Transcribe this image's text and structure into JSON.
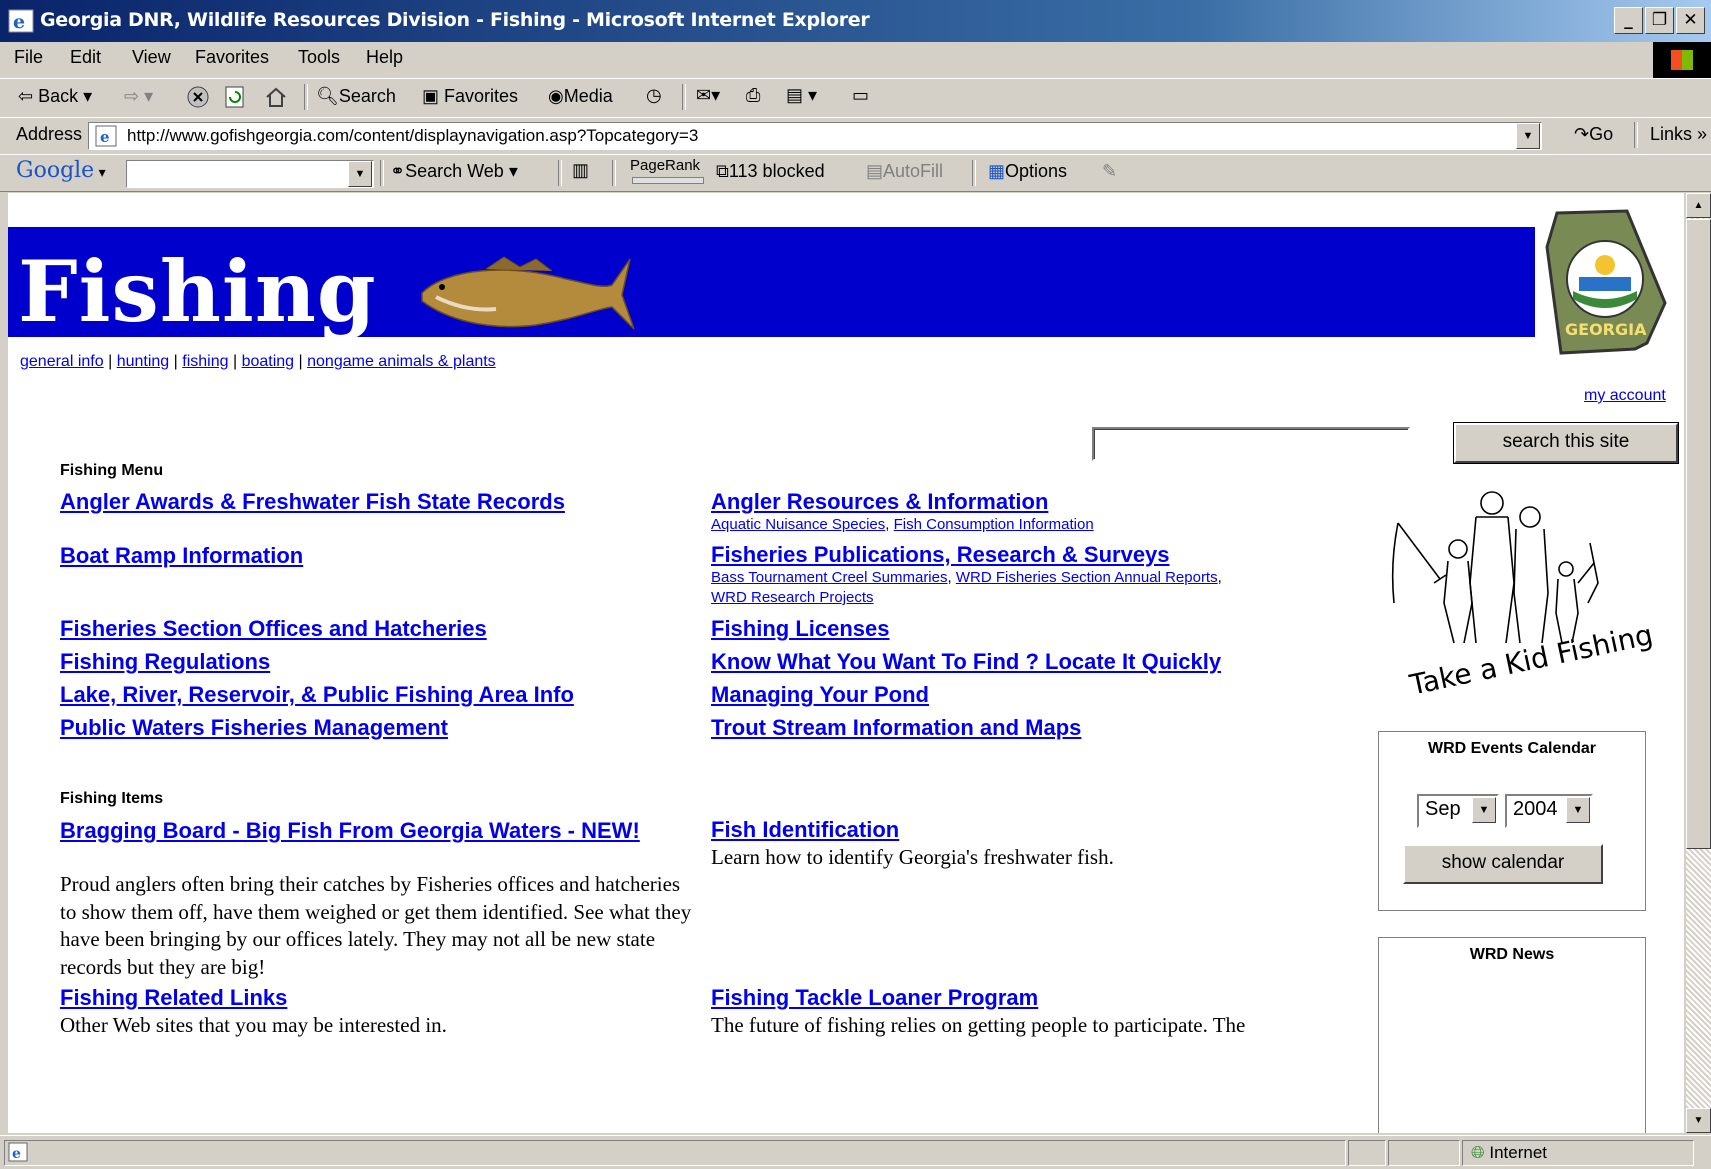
{
  "window": {
    "title": "Georgia DNR, Wildlife Resources Division - Fishing - Microsoft Internet Explorer",
    "min_label": "_",
    "max_label": "❐",
    "close_label": "✕"
  },
  "menu": [
    "File",
    "Edit",
    "View",
    "Favorites",
    "Tools",
    "Help"
  ],
  "toolbar": {
    "back": "Back",
    "search": "Search",
    "favorites": "Favorites",
    "media": "Media"
  },
  "address": {
    "label": "Address",
    "url": "http://www.gofishgeorgia.com/content/displaynavigation.asp?Topcategory=3",
    "go": "Go",
    "links": "Links"
  },
  "google_bar": {
    "logo": "Google",
    "search_web": "Search Web",
    "pagerank": "PageRank",
    "blocked": "113 blocked",
    "autofill": "AutoFill",
    "options": "Options"
  },
  "page": {
    "title": "Fishing",
    "nav": [
      "general info",
      "hunting",
      "fishing",
      "boating",
      "nongame animals & plants"
    ],
    "nav_sep": "|",
    "my_account": "my account",
    "search_button": "search this site",
    "seal_text": "GEORGIA",
    "kid_caption": "Take a Kid Fishing"
  },
  "fishing_menu": {
    "heading": "Fishing Menu",
    "left": [
      "Angler Awards & Freshwater Fish State Records",
      "Boat Ramp Information",
      "Fisheries Section Offices and Hatcheries",
      "Fishing Regulations",
      "Lake, River, Reservoir, & Public Fishing Area Info",
      "Public Waters Fisheries Management"
    ],
    "right": [
      "Angler Resources & Information",
      "Fisheries Publications, Research & Surveys",
      "Fishing Licenses",
      "Know What You Want To Find ? Locate It Quickly",
      "Managing Your Pond",
      "Trout Stream Information and Maps"
    ],
    "angler_sub": [
      "Aquatic Nuisance Species",
      "Fish Consumption Information"
    ],
    "pubs_sub": [
      "Bass Tournament Creel Summaries",
      "WRD Fisheries Section Annual Reports",
      "WRD Research Projects"
    ]
  },
  "fishing_items": {
    "heading": "Fishing Items",
    "bragging_title": "Bragging Board - Big Fish From Georgia Waters - NEW!",
    "bragging_desc": "Proud anglers often bring their catches by Fisheries offices and hatcheries to show them off, have them weighed or get them identified. See what they have been bringing by our offices lately. They may not all be new state records but they are big!",
    "fishid_title": "Fish Identification",
    "fishid_desc": "Learn how to identify Georgia's freshwater fish.",
    "links_title": "Fishing Related Links",
    "links_desc": "Other Web sites that you may be interested in.",
    "tackle_title": "Fishing Tackle Loaner Program",
    "tackle_desc": "The future of fishing relies on getting people to participate. The"
  },
  "calendar": {
    "title": "WRD Events Calendar",
    "month": "Sep",
    "year": "2004",
    "button": "show calendar"
  },
  "news": {
    "title": "WRD News"
  },
  "status": {
    "zone": "Internet"
  }
}
